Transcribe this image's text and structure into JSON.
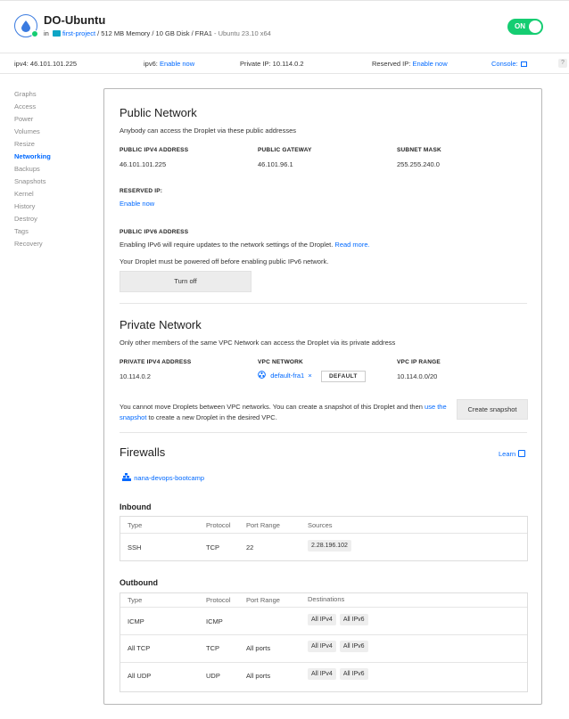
{
  "header": {
    "title": "DO-Ubuntu",
    "in_label": "in",
    "project": "first-project",
    "specs": "/ 512 MB Memory / 10 GB Disk / FRA1",
    "os": "- Ubuntu 23.10 x64",
    "power_label": "ON"
  },
  "infobar": {
    "ipv4": "ipv4: 46.101.101.225",
    "ipv6_label": "ipv6:",
    "ipv6_action": "Enable now",
    "private_ip": "Private IP:  10.114.0.2",
    "reserved_label": "Reserved IP:",
    "reserved_action": "Enable now",
    "console": "Console:",
    "help": "?"
  },
  "sidebar": {
    "items": [
      {
        "label": "Graphs",
        "active": false
      },
      {
        "label": "Access",
        "active": false
      },
      {
        "label": "Power",
        "active": false
      },
      {
        "label": "Volumes",
        "active": false
      },
      {
        "label": "Resize",
        "active": false
      },
      {
        "label": "Networking",
        "active": true
      },
      {
        "label": "Backups",
        "active": false
      },
      {
        "label": "Snapshots",
        "active": false
      },
      {
        "label": "Kernel",
        "active": false
      },
      {
        "label": "History",
        "active": false
      },
      {
        "label": "Destroy",
        "active": false
      },
      {
        "label": "Tags",
        "active": false
      },
      {
        "label": "Recovery",
        "active": false
      }
    ]
  },
  "public_network": {
    "title": "Public Network",
    "description": "Anybody can access the Droplet via these public addresses",
    "ipv4_cap": "PUBLIC IPV4 ADDRESS",
    "ipv4": "46.101.101.225",
    "gateway_cap": "PUBLIC GATEWAY",
    "gateway": "46.101.96.1",
    "mask_cap": "SUBNET MASK",
    "mask": "255.255.240.0",
    "reserved_cap": "RESERVED IP:",
    "reserved_action": "Enable now",
    "ipv6_cap": "PUBLIC IPV6 ADDRESS",
    "ipv6_note": "Enabling IPv6 will require updates to the network settings of the Droplet.",
    "read_more": "Read more.",
    "power_note": "Your Droplet must be powered off before enabling public IPv6 network.",
    "turn_off": "Turn off"
  },
  "private_network": {
    "title": "Private Network",
    "description": "Only other members of the same VPC Network can access the Droplet via its private address",
    "ipv4_cap": "PRIVATE IPV4 ADDRESS",
    "ipv4": "10.114.0.2",
    "vpc_cap": "VPC NETWORK",
    "vpc": "default-fra1",
    "default_tag": "DEFAULT",
    "range_cap": "VPC IP RANGE",
    "range": "10.114.0.0/20",
    "note_1": "You cannot move Droplets between VPC networks. You can create a snapshot of this Droplet and then",
    "note_link": "use the snapshot",
    "note_2": "to create a new Droplet in the desired VPC.",
    "snapshot_button": "Create snapshot"
  },
  "firewalls": {
    "title": "Firewalls",
    "learn": "Learn",
    "firewall_name": "nana-devops-bootcamp",
    "inbound_title": "Inbound",
    "inbound_headers": [
      "Type",
      "Protocol",
      "Port Range",
      "Sources"
    ],
    "inbound_rows": [
      {
        "type": "SSH",
        "protocol": "TCP",
        "ports": "22",
        "tags": [
          "2.28.196.102"
        ]
      }
    ],
    "outbound_title": "Outbound",
    "outbound_headers": [
      "Type",
      "Protocol",
      "Port Range",
      "Destinations"
    ],
    "outbound_rows": [
      {
        "type": "ICMP",
        "protocol": "ICMP",
        "ports": "",
        "tags": [
          "All IPv4",
          "All IPv6"
        ]
      },
      {
        "type": "All TCP",
        "protocol": "TCP",
        "ports": "All ports",
        "tags": [
          "All IPv4",
          "All IPv6"
        ]
      },
      {
        "type": "All UDP",
        "protocol": "UDP",
        "ports": "All ports",
        "tags": [
          "All IPv4",
          "All IPv6"
        ]
      }
    ]
  },
  "colors": {
    "accent": "#0069ff",
    "power_on": "#15cd72"
  }
}
